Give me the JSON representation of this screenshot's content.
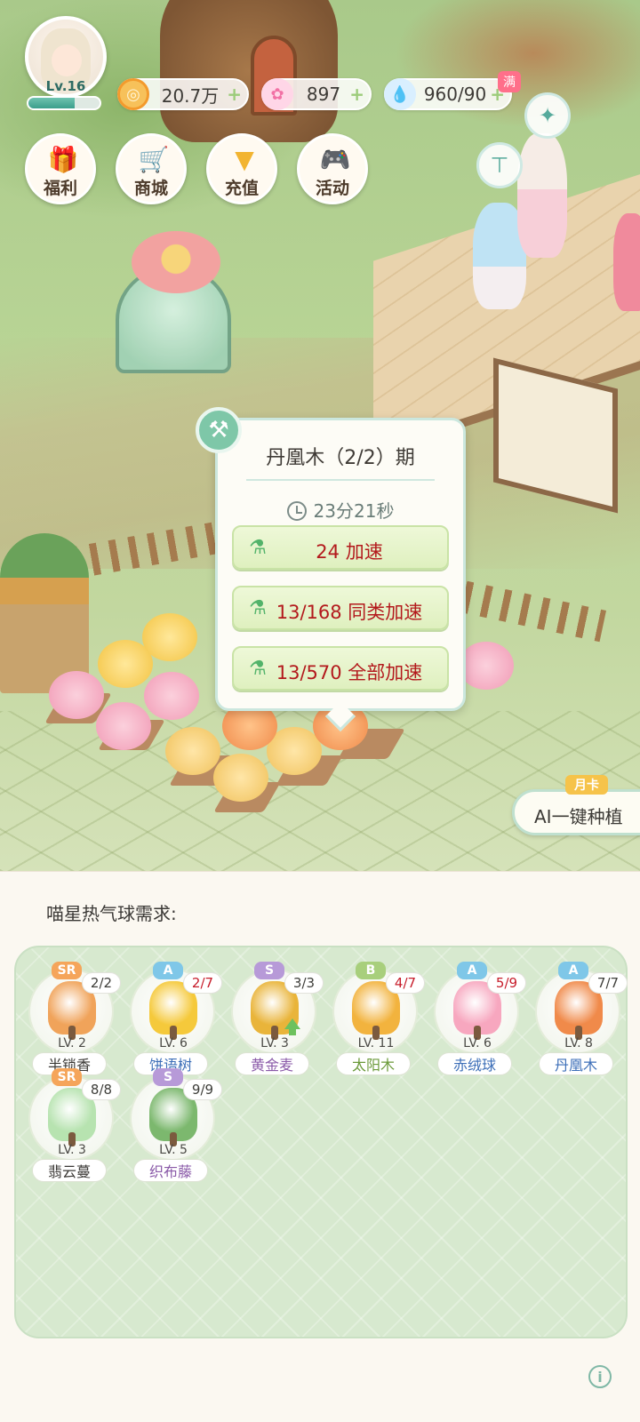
{
  "player": {
    "level_label": "Lv.16",
    "xp_fraction": 0.65
  },
  "resources": {
    "coins": {
      "value": "20.7万",
      "icon": "coin-icon"
    },
    "stars": {
      "value": "897",
      "icon": "star-flower-icon"
    },
    "water": {
      "value": "960/90",
      "icon": "water-drop-icon",
      "badge": "满"
    }
  },
  "menu": [
    {
      "label": "福利",
      "icon": "gift-icon"
    },
    {
      "label": "商城",
      "icon": "shopping-cart-icon"
    },
    {
      "label": "充值",
      "icon": "gem-icon"
    },
    {
      "label": "活动",
      "icon": "gamepad-icon"
    }
  ],
  "popup": {
    "title": "丹凰木（2/2）期",
    "timer": "23分21秒",
    "buttons": [
      {
        "label": "24 加速"
      },
      {
        "label": "13/168 同类加速"
      },
      {
        "label": "13/570 全部加速"
      }
    ]
  },
  "ai_plant": {
    "label": "AI一键种植",
    "badge": "月卡"
  },
  "demand": {
    "title": "喵星热气球需求:",
    "items": [
      {
        "name": "半锁香",
        "rarity": "SR",
        "count": "2/2",
        "level": "LV. 2",
        "short": false,
        "name_color": "#3b3936",
        "plant_color": "#f0a35a",
        "rarity_color": "#f5a55a"
      },
      {
        "name": "饼语树",
        "rarity": "A",
        "count": "2/7",
        "level": "LV. 6",
        "short": true,
        "name_color": "#3d6fb8",
        "plant_color": "#f5c93b",
        "rarity_color": "#7fc7e8"
      },
      {
        "name": "黄金麦",
        "rarity": "S",
        "count": "3/3",
        "level": "LV. 3",
        "short": false,
        "name_color": "#8a5aa8",
        "plant_color": "#e9b43a",
        "rarity_color": "#b79ad8",
        "upgrade": true
      },
      {
        "name": "太阳木",
        "rarity": "B",
        "count": "4/7",
        "level": "LV. 11",
        "short": true,
        "name_color": "#6b9a3a",
        "plant_color": "#f2b33e",
        "rarity_color": "#a8cf7c"
      },
      {
        "name": "赤绒球",
        "rarity": "A",
        "count": "5/9",
        "level": "LV. 6",
        "short": true,
        "name_color": "#3d6fb8",
        "plant_color": "#f7a7bf",
        "rarity_color": "#7fc7e8"
      },
      {
        "name": "丹凰木",
        "rarity": "A",
        "count": "7/7",
        "level": "LV. 8",
        "short": false,
        "name_color": "#3d6fb8",
        "plant_color": "#f08a4a",
        "rarity_color": "#7fc7e8"
      },
      {
        "name": "翡云蔓",
        "rarity": "SR",
        "count": "8/8",
        "level": "LV. 3",
        "short": false,
        "name_color": "#3b3936",
        "plant_color": "#b7e3b0",
        "rarity_color": "#f5a55a"
      },
      {
        "name": "织布藤",
        "rarity": "S",
        "count": "9/9",
        "level": "LV. 5",
        "short": false,
        "name_color": "#8a5aa8",
        "plant_color": "#7cb86e",
        "rarity_color": "#b79ad8"
      }
    ]
  },
  "info_icon": "info-icon"
}
